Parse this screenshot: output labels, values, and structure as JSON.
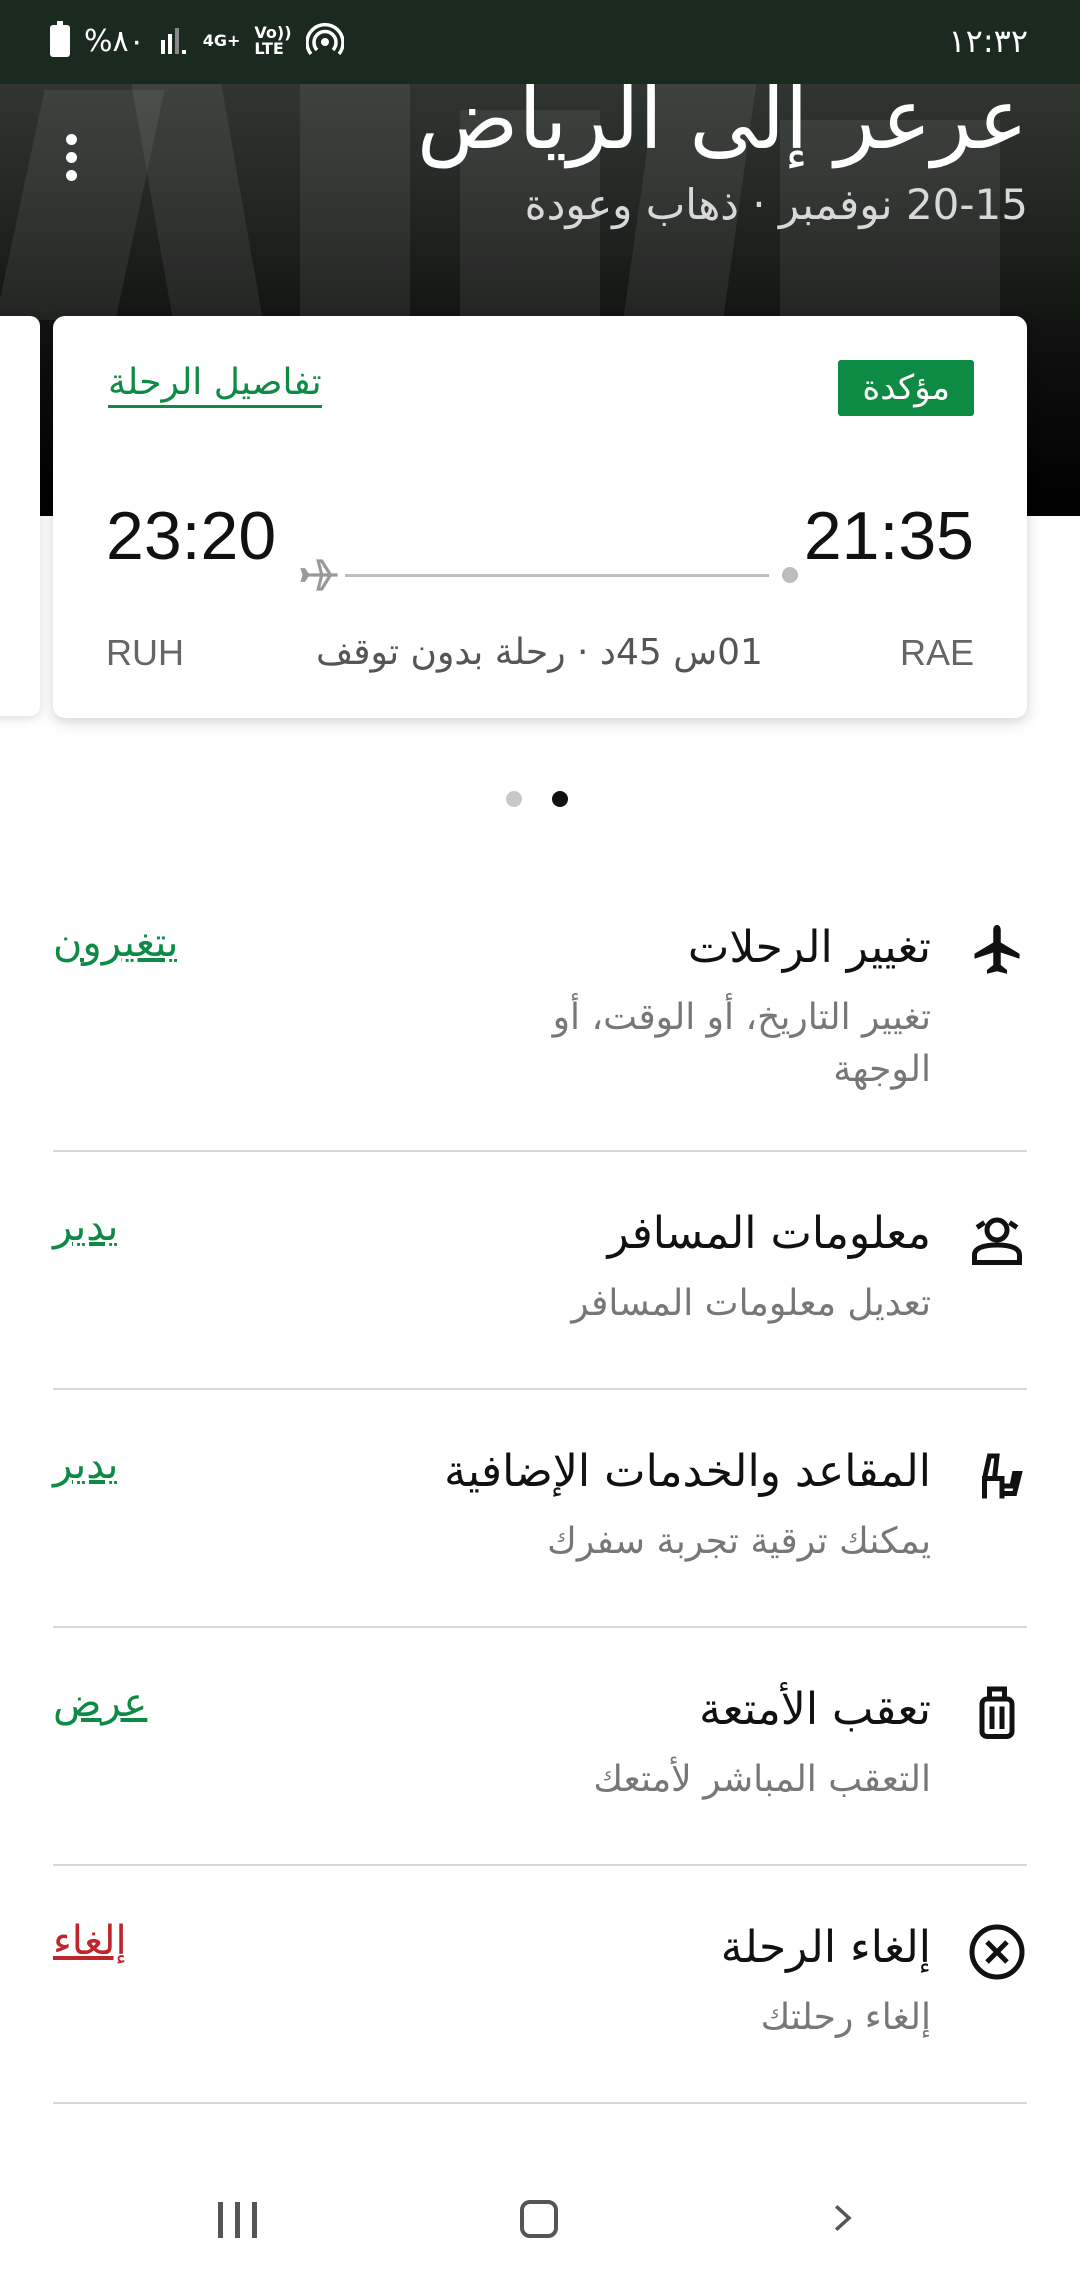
{
  "status": {
    "time": "١٢:٣٢",
    "battery": "%٨٠",
    "net": "4G+",
    "volte": "Vo)) LTE"
  },
  "header": {
    "title": "عرعر إلى الرياض",
    "subtitle": "20-15 نوفمبر · ذهاب وعودة"
  },
  "card": {
    "status_badge": "مؤكدة",
    "details_link": "تفاصيل الرحلة",
    "departure_time": "21:35",
    "arrival_time": "23:20",
    "from_code": "RAE",
    "to_code": "RUH",
    "duration": "01س 45د · رحلة بدون توقف"
  },
  "pager": {
    "count": 2,
    "active_index": 1
  },
  "options": [
    {
      "title": "تغيير الرحلات",
      "desc": "تغيير التاريخ، أو الوقت، أو الوجهة",
      "action": "يتغيرون",
      "icon": "airplane-icon",
      "action_color": "#0d8a43"
    },
    {
      "title": "معلومات المسافر",
      "desc": "تعديل معلومات المسافر",
      "action": "يدير",
      "icon": "passenger-icon",
      "action_color": "#0d8a43"
    },
    {
      "title": "المقاعد والخدمات الإضافية",
      "desc": "يمكنك ترقية تجربة سفرك",
      "action": "يدير",
      "icon": "seat-icon",
      "action_color": "#0d8a43"
    },
    {
      "title": "تعقب الأمتعة",
      "desc": "التعقب المباشر لأمتعك",
      "action": "عرض",
      "icon": "luggage-icon",
      "action_color": "#0d8a43"
    },
    {
      "title": "إلغاء الرحلة",
      "desc": "إلغاء رحلتك",
      "action": "إلغاء",
      "icon": "cancel-circle-icon",
      "action_color": "#c0252c"
    }
  ],
  "colors": {
    "accent": "#0d8a43",
    "danger": "#c0252c",
    "header_bg": "#000000"
  }
}
